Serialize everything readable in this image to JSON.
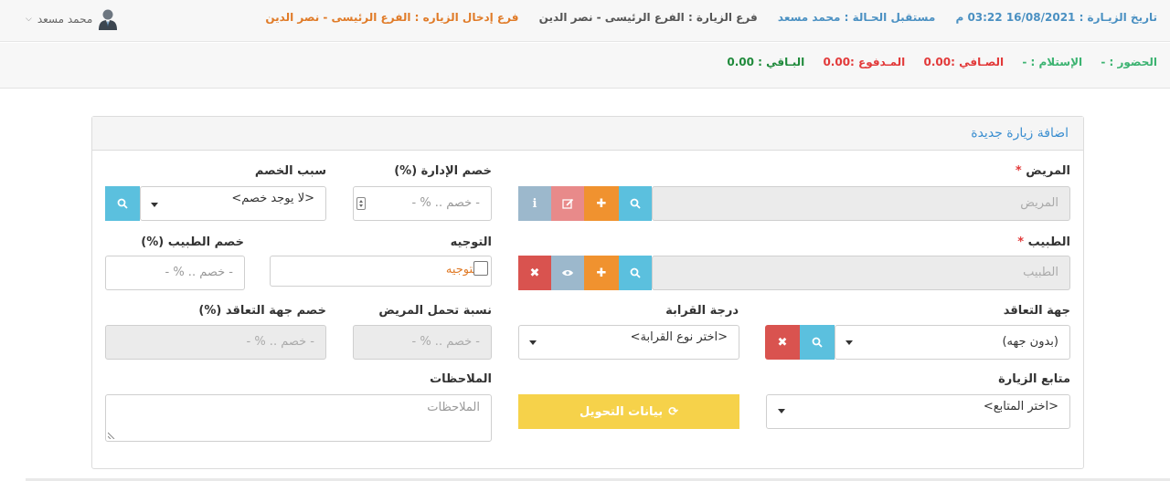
{
  "header": {
    "visit_date_label": "تاريخ الزيـارة :",
    "visit_date_value": "16/08/2021 03:22 م",
    "receiver_label": "مستقبل الحـالة :",
    "receiver_value": "محمد مسعد",
    "visit_branch_label": "فرع الزيارة :",
    "visit_branch_value": "الفرع الرئيسى - نصر الدين",
    "entry_branch_label": "فرع إدخال الزياره :",
    "entry_branch_value": "الفرع الرئيسى - نصر الدين",
    "user_name": "محمد مسعد"
  },
  "stats": {
    "attendance_label": "الحضور :",
    "attendance_value": "-",
    "receipt_label": "الإستلام :",
    "receipt_value": "-",
    "net_label": "الصـافي :",
    "net_value": "0.00",
    "paid_label": "المـدفوع :",
    "paid_value": "0.00",
    "remaining_label": "البـاقي :",
    "remaining_value": "0.00"
  },
  "panel": {
    "title": "اضافة زيارة جديدة"
  },
  "form": {
    "patient_label": "المريض",
    "patient_placeholder": "المريض",
    "doctor_label": "الطبيب",
    "doctor_placeholder": "الطبيب",
    "admin_discount_label": "خصم الإدارة (%)",
    "admin_discount_placeholder": "- خصم .. % -",
    "discount_reason_label": "سبب الخصم",
    "discount_reason_value": "<لا يوجد خصم>",
    "referral_label": "التوجيه",
    "referral_checkbox_label": "التوجيه",
    "doctor_discount_label": "خصم الطبيب (%)",
    "doctor_discount_placeholder": "- خصم .. % -",
    "contract_label": "جهة التعاقد",
    "contract_value": "(بدون جهه)",
    "relation_label": "درجة القرابة",
    "relation_value": "<اختر نوع القرابة>",
    "patient_share_label": "نسبة تحمل المريض",
    "patient_share_placeholder": "- خصم .. % -",
    "contract_discount_label": "خصم جهة التعاقد (%)",
    "contract_discount_placeholder": "- خصم .. % -",
    "followup_label": "متابع الزيارة",
    "followup_value": "<اختر المتابع>",
    "transfer_button": "بيانات التحويل",
    "notes_label": "الملاحظات",
    "notes_placeholder": "الملاحظات",
    "required_mark": "*"
  }
}
